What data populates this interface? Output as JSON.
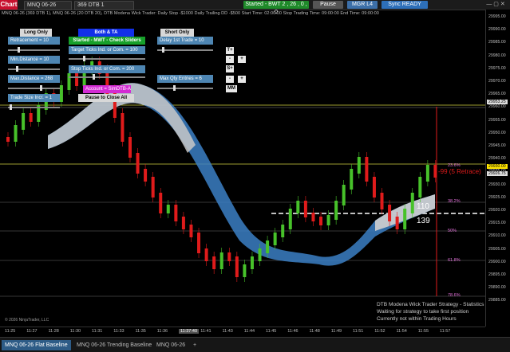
{
  "toolbar": {
    "chart_tab": "Chart",
    "instrument": "MNQ 06-26",
    "template": "369 DTB 1",
    "status": "Started - BWT 2 , 26 , 0 , 0",
    "pause": "Pause",
    "mgr": "MGR L4",
    "sync": "Sync READY"
  },
  "info_line": "MNQ 06-26 (369 DTB 1), MNQ 06-26 (20 DTB 20), DTB Modena Wick Trader: Daily Stop -$1000  Daily Trailing DD -$500  Start Time: 02:00:00  Stop Trading Time: 09:00:00  End Time: 09:00:00",
  "panel": {
    "long_only": "Long Only",
    "both_ta": "Both & TA",
    "short_only": "Short Only",
    "started": "Started - MWT - Check Sliders",
    "retracement": "Retracement = 10",
    "target_ticks": "Target Ticks Ind. or Com. = 100",
    "delay": "Delay 1st Trade = 10",
    "min_distance": "Min.Distance = 10",
    "stop_ticks": "Stop Ticks Ind. or Com. = 200",
    "max_distance": "Max.Distance = 268",
    "max_qty": "Max Qty Entries = 6",
    "account": "Account = SimDTB-A",
    "pause_close": "Pause to Close All",
    "trade_size": "Trade Size Incr. = 1",
    "t_plus": "T+",
    "s_plus": "S+",
    "mm": "MM",
    "minus": "-",
    "plus": "+"
  },
  "price_axis": {
    "ticks": [
      "29995.00",
      "29990.00",
      "29985.00",
      "29980.00",
      "29975.00",
      "29970.00",
      "29965.00",
      "29960.00",
      "29955.00",
      "29950.00",
      "29945.00",
      "29940.00",
      "29935.00",
      "29930.00",
      "29925.00",
      "29920.00",
      "29915.00",
      "29910.00",
      "29905.00",
      "29900.00",
      "29895.00",
      "29890.00",
      "29885.00"
    ],
    "marker_top": "29953.25",
    "marker_mid": "29930.00",
    "marker_low": "29926.75"
  },
  "fib_labels": {
    "f236": "23.6%",
    "f382": "38.2%",
    "f50": "50%",
    "f618": "61.8%",
    "f786": "78.6%"
  },
  "overlay": {
    "retrace": "-99 (5 Retrace)",
    "n110": "110",
    "n139": "139"
  },
  "time_axis": [
    "11:25",
    "11:27",
    "11:28",
    "11:30",
    "11:31",
    "11:33",
    "11:35",
    "11:36",
    "11:37:40",
    "11:41",
    "11:43",
    "11:44",
    "11:45",
    "11:46",
    "11:48",
    "11:49",
    "11:51",
    "11:52",
    "11:54",
    "11:55",
    "11:57"
  ],
  "copyright": "© 2026 NinjaTrader, LLC",
  "stats": {
    "line1": "DTB Modena Wick Trader Strategy - Statistics",
    "line2": "Waiting for strategy to take first position",
    "line3": "Currently not within Trading Hours"
  },
  "tabs": [
    "MNQ 06-26 Flat Baseline",
    "MNQ 06-26 Trending Baseline",
    "MNQ 06-26"
  ],
  "colors": {
    "up": "#47c22a",
    "down": "#e01b1b",
    "ribbon": "#3b7fc4",
    "fib": "#e06fd8"
  }
}
